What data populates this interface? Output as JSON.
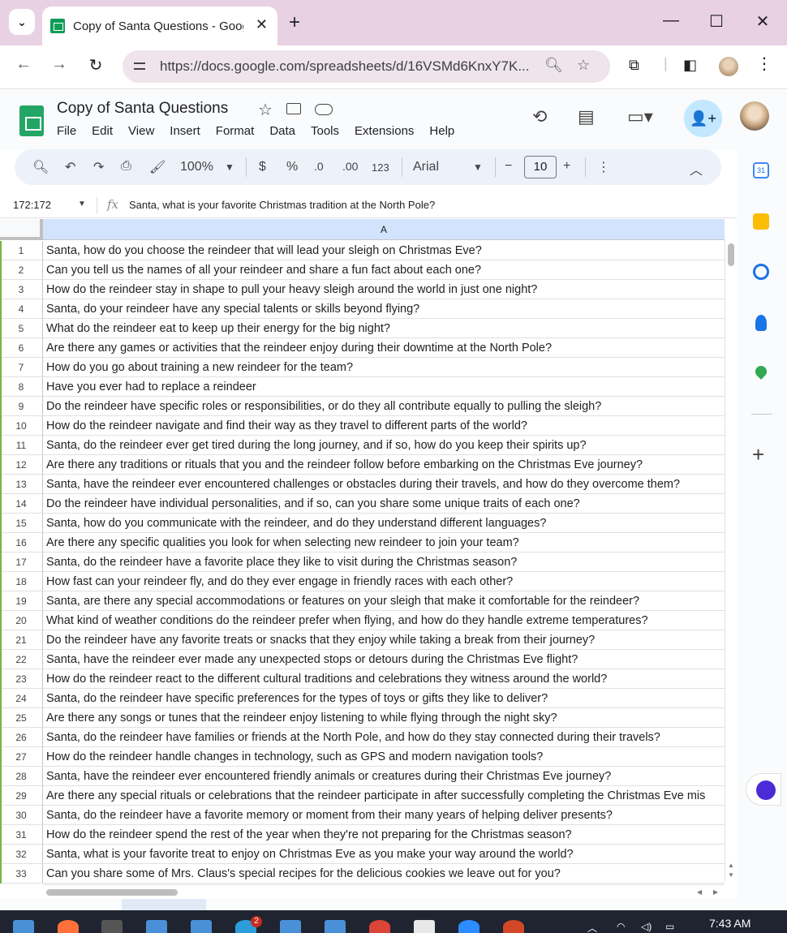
{
  "browser": {
    "tab_title": "Copy of Santa Questions - Google Sheets",
    "url": "https://docs.google.com/spreadsheets/d/16VSMd6KnxY7K..."
  },
  "doc": {
    "title": "Copy of Santa Questions",
    "menus": [
      "File",
      "Edit",
      "View",
      "Insert",
      "Format",
      "Data",
      "Tools",
      "Extensions",
      "Help"
    ]
  },
  "toolbar": {
    "zoom": "100%",
    "currency": "$",
    "percent": "%",
    "dec_decrease": ".0",
    "dec_increase": ".00",
    "format_123": "123",
    "font": "Arial",
    "font_size": "10"
  },
  "formula_bar": {
    "name_box": "172:172",
    "fx": "fx",
    "content": "Santa, what is your favorite Christmas tradition at the North Pole?"
  },
  "grid": {
    "column_header": "A",
    "rows": [
      {
        "num": "1",
        "text": "Santa, how do you choose the reindeer that will lead your sleigh on Christmas Eve?"
      },
      {
        "num": "2",
        "text": "Can you tell us the names of all your reindeer and share a fun fact about each one?"
      },
      {
        "num": "3",
        "text": "How do the reindeer stay in shape to pull your heavy sleigh around the world in just one night?"
      },
      {
        "num": "4",
        "text": "Santa, do your reindeer have any special talents or skills beyond flying?"
      },
      {
        "num": "5",
        "text": "What do the reindeer eat to keep up their energy for the big night?"
      },
      {
        "num": "6",
        "text": "Are there any games or activities that the reindeer enjoy during their downtime at the North Pole?"
      },
      {
        "num": "7",
        "text": "How do you go about training a new reindeer for the team?"
      },
      {
        "num": "8",
        "text": "Have you ever had to replace a reindeer"
      },
      {
        "num": "9",
        "text": "Do the reindeer have specific roles or responsibilities, or do they all contribute equally to pulling the sleigh?"
      },
      {
        "num": "10",
        "text": "How do the reindeer navigate and find their way as they travel to different parts of the world?"
      },
      {
        "num": "11",
        "text": "Santa, do the reindeer ever get tired during the long journey, and if so, how do you keep their spirits up?"
      },
      {
        "num": "12",
        "text": "Are there any traditions or rituals that you and the reindeer follow before embarking on the Christmas Eve journey?"
      },
      {
        "num": "13",
        "text": "Santa, have the reindeer ever encountered challenges or obstacles during their travels, and how do they overcome them?"
      },
      {
        "num": "14",
        "text": "Do the reindeer have individual personalities, and if so, can you share some unique traits of each one?"
      },
      {
        "num": "15",
        "text": "Santa, how do you communicate with the reindeer, and do they understand different languages?"
      },
      {
        "num": "16",
        "text": "Are there any specific qualities you look for when selecting new reindeer to join your team?"
      },
      {
        "num": "17",
        "text": "Santa, do the reindeer have a favorite place they like to visit during the Christmas season?"
      },
      {
        "num": "18",
        "text": "How fast can your reindeer fly, and do they ever engage in friendly races with each other?"
      },
      {
        "num": "19",
        "text": "Santa, are there any special accommodations or features on your sleigh that make it comfortable for the reindeer?"
      },
      {
        "num": "20",
        "text": "What kind of weather conditions do the reindeer prefer when flying, and how do they handle extreme temperatures?"
      },
      {
        "num": "21",
        "text": "Do the reindeer have any favorite treats or snacks that they enjoy while taking a break from their journey?"
      },
      {
        "num": "22",
        "text": "Santa, have the reindeer ever made any unexpected stops or detours during the Christmas Eve flight?"
      },
      {
        "num": "23",
        "text": "How do the reindeer react to the different cultural traditions and celebrations they witness around the world?"
      },
      {
        "num": "24",
        "text": "Santa, do the reindeer have specific preferences for the types of toys or gifts they like to deliver?"
      },
      {
        "num": "25",
        "text": "Are there any songs or tunes that the reindeer enjoy listening to while flying through the night sky?"
      },
      {
        "num": "26",
        "text": "Santa, do the reindeer have families or friends at the North Pole, and how do they stay connected during their travels?"
      },
      {
        "num": "27",
        "text": "How do the reindeer handle changes in technology, such as GPS and modern navigation tools?"
      },
      {
        "num": "28",
        "text": "Santa, have the reindeer ever encountered friendly animals or creatures during their Christmas Eve journey?"
      },
      {
        "num": "29",
        "text": "Are there any special rituals or celebrations that the reindeer participate in after successfully completing the Christmas Eve mis"
      },
      {
        "num": "30",
        "text": "Santa, do the reindeer have a favorite memory or moment from their many years of helping deliver presents?"
      },
      {
        "num": "31",
        "text": "How do the reindeer spend the rest of the year when they're not preparing for the Christmas season?"
      },
      {
        "num": "32",
        "text": "Santa, what is your favorite treat to enjoy on Christmas Eve as you make your way around the world?"
      },
      {
        "num": "33",
        "text": "Can you share some of Mrs. Claus's special recipes for the delicious cookies we leave out for you?"
      }
    ]
  },
  "side_panel": {
    "calendar_day": "31"
  },
  "taskbar": {
    "time": "7:43 AM",
    "notification_count": "2"
  },
  "colors": {
    "titlebar": "#e9d1e4",
    "omnibox": "#efe4ec",
    "column_header_selected": "#d3e3fd",
    "share_button": "#c2e7ff",
    "sheets_green": "#23a566"
  },
  "icons": [
    "chevron-down-icon",
    "close-icon",
    "plus-icon",
    "minimize-icon",
    "maximize-icon",
    "back-arrow-icon",
    "forward-arrow-icon",
    "reload-icon",
    "site-info-icon",
    "zoom-icon",
    "star-icon",
    "extensions-icon",
    "sidebar-icon",
    "more-vert-icon",
    "history-icon",
    "comment-icon",
    "meet-icon",
    "add-person-icon",
    "search-icon",
    "undo-icon",
    "redo-icon",
    "print-icon",
    "paint-format-icon",
    "minus-icon",
    "chevron-up-icon",
    "calendar-icon",
    "keep-icon",
    "tasks-icon",
    "contacts-icon",
    "maps-icon"
  ]
}
